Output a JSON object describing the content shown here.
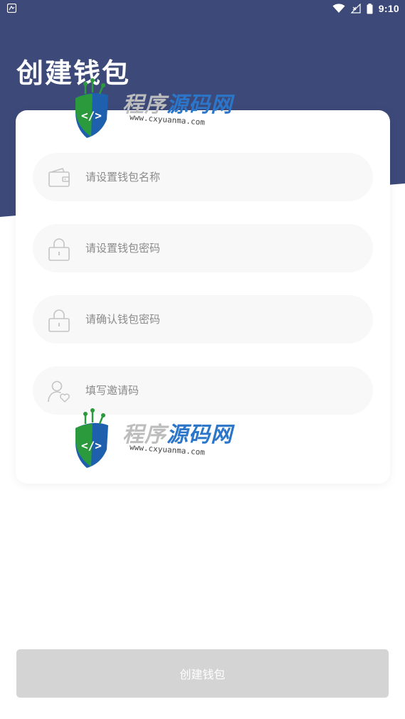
{
  "status_bar": {
    "time": "9:10"
  },
  "header": {
    "title": "创建钱包",
    "background_color": "#3d4a79"
  },
  "form": {
    "fields": [
      {
        "icon": "wallet-icon",
        "placeholder": "请设置钱包名称",
        "value": ""
      },
      {
        "icon": "lock-icon",
        "placeholder": "请设置钱包密码",
        "value": ""
      },
      {
        "icon": "lock-icon",
        "placeholder": "请确认钱包密码",
        "value": ""
      },
      {
        "icon": "user-heart-icon",
        "placeholder": "填写邀请码",
        "value": ""
      }
    ]
  },
  "watermark": {
    "text_part1": "程序",
    "text_part2": "源码网",
    "url": "www.cxyuanma.com"
  },
  "footer": {
    "create_label": "创建钱包",
    "button_color": "#d4d4d4"
  }
}
